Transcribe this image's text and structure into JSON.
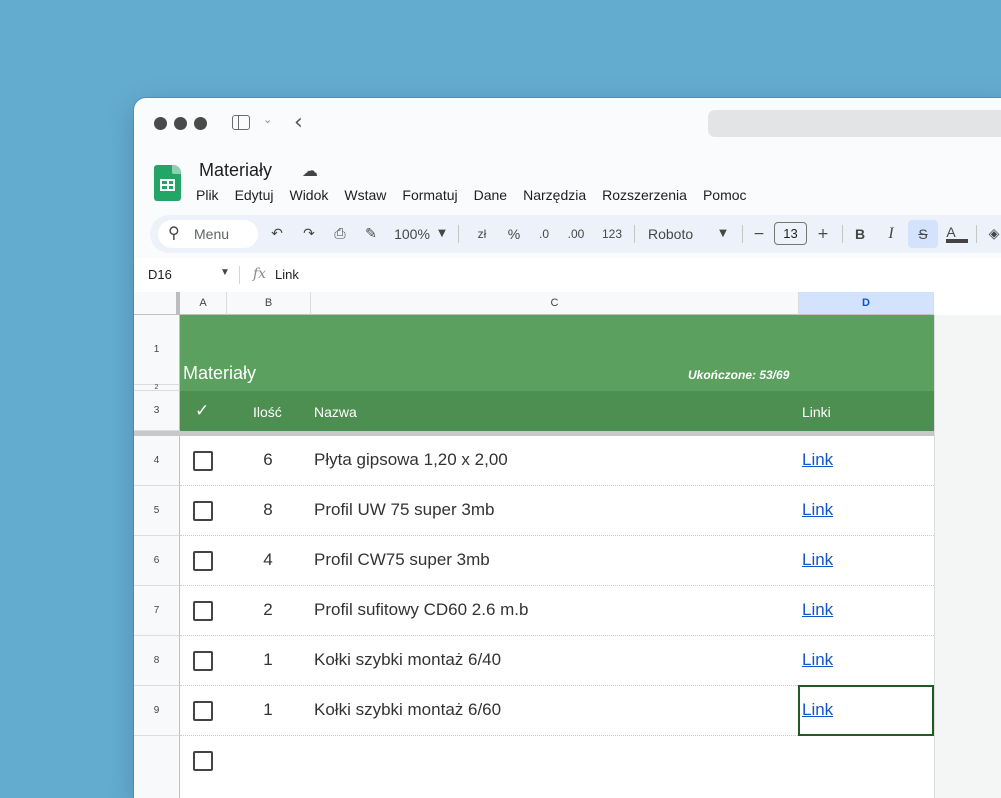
{
  "app": {
    "title": "Materiały",
    "menu": [
      "Plik",
      "Edytuj",
      "Widok",
      "Wstaw",
      "Formatuj",
      "Dane",
      "Narzędzia",
      "Rozszerzenia",
      "Pomoc"
    ]
  },
  "toolbar": {
    "search_label": "Menu",
    "zoom": "100%",
    "currency": "zł",
    "percent": "%",
    "dec_decrease": ".0",
    "dec_increase": ".00",
    "number_format": "123",
    "font": "Roboto",
    "font_size": "13",
    "bold": "B",
    "italic": "I",
    "text_color": "A"
  },
  "formula_bar": {
    "cell_ref": "D16",
    "fx": "fx",
    "value": "Link"
  },
  "grid": {
    "columns": [
      "A",
      "B",
      "C",
      "D"
    ],
    "selected_column": "D",
    "row_numbers": [
      "1",
      "2",
      "3",
      "4",
      "5",
      "6",
      "7",
      "8",
      "9"
    ],
    "banner_title": "Materiały",
    "banner_status": "Ukończone: 53/69",
    "header": {
      "check": "✓",
      "qty": "Ilość",
      "name": "Nazwa",
      "links": "Linki"
    },
    "rows": [
      {
        "qty": "6",
        "name": "Płyta gipsowa 1,20 x 2,00",
        "link": "Link"
      },
      {
        "qty": "8",
        "name": "Profil UW 75 super 3mb",
        "link": "Link"
      },
      {
        "qty": "4",
        "name": "Profil CW75 super 3mb",
        "link": "Link"
      },
      {
        "qty": "2",
        "name": "Profil sufitowy CD60 2.6 m.b",
        "link": "Link"
      },
      {
        "qty": "1",
        "name": "Kołki szybki montaż 6/40",
        "link": "Link"
      },
      {
        "qty": "1",
        "name": "Kołki szybki montaż 6/60",
        "link": "Link"
      }
    ]
  },
  "colors": {
    "desktop": "#63acd0",
    "banner": "#5ba05e",
    "header_row": "#4d8f51",
    "link": "#1155cc",
    "selection": "#1f5b22"
  }
}
